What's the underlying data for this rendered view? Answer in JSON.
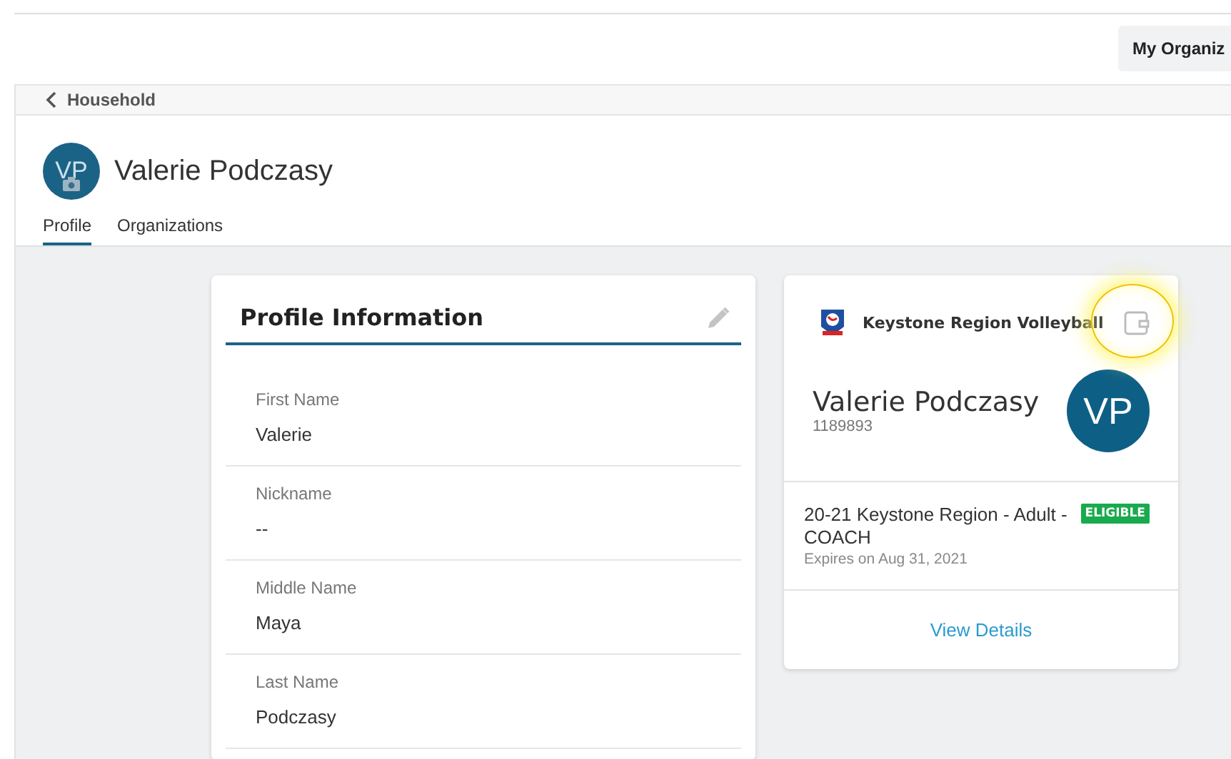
{
  "top_bar": {
    "button": "My Organiz"
  },
  "breadcrumb": {
    "back_label": "Household"
  },
  "profile": {
    "initials": "VP",
    "name": "Valerie Podczasy"
  },
  "tabs": [
    {
      "label": "Profile",
      "selected": true
    },
    {
      "label": "Organizations",
      "selected": false
    }
  ],
  "profile_card": {
    "title": "Profile Information",
    "fields": [
      {
        "label": "First Name",
        "value": "Valerie"
      },
      {
        "label": "Nickname",
        "value": "--"
      },
      {
        "label": "Middle Name",
        "value": "Maya"
      },
      {
        "label": "Last Name",
        "value": "Podczasy"
      }
    ]
  },
  "membership_card": {
    "organization": "Keystone Region Volleyball",
    "wallet_highlighted": true,
    "member_name": "Valerie Podczasy",
    "member_id": "1189893",
    "initials": "VP",
    "membership": {
      "title": "20-21 Keystone Region - Adult - COACH",
      "status": "ELIGIBLE",
      "expires": "Expires on Aug 31, 2021"
    },
    "link": "View Details"
  }
}
